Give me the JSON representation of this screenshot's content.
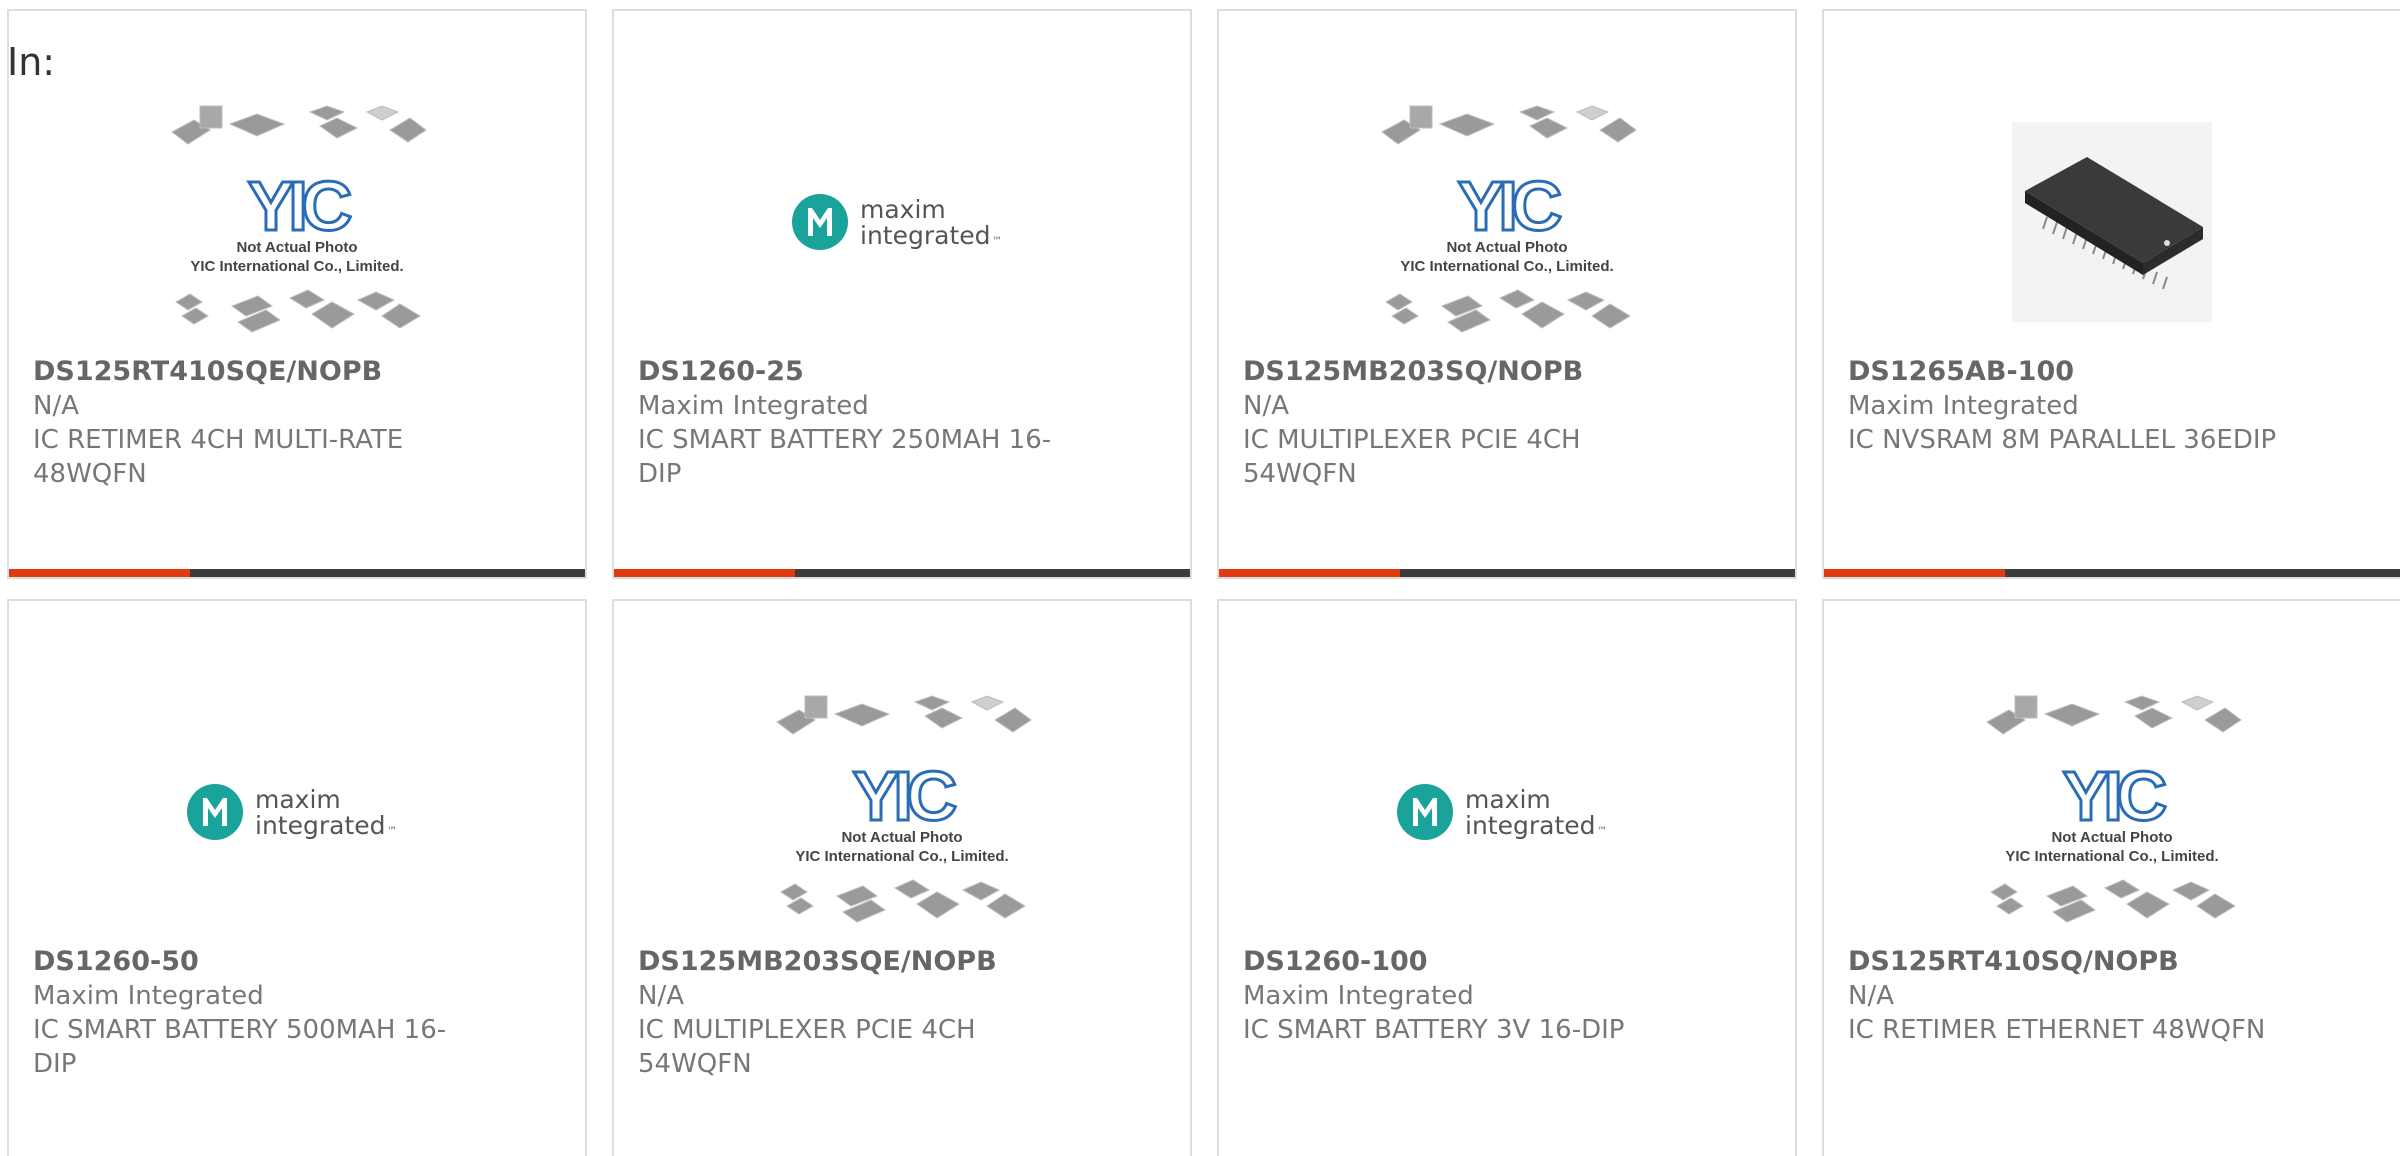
{
  "header": {
    "in_label": "In:"
  },
  "placeholder": {
    "line1": "Not Actual Photo",
    "line2": "YIC International Co., Limited.",
    "logo": "YIC"
  },
  "maxim_logo": {
    "line1": "maxim",
    "line2": "integrated",
    "tm": "™"
  },
  "colors": {
    "accent": "#e03a10",
    "bar": "#3c3c3c",
    "maxim_teal": "#1aa39a",
    "yic_blue": "#2a6db5"
  },
  "products": [
    {
      "part": "DS125RT410SQE/NOPB",
      "maker": "N/A",
      "desc": "IC RETIMER 4CH MULTI-RATE 48WQFN",
      "image": "yic-placeholder"
    },
    {
      "part": "DS1260-25",
      "maker": "Maxim Integrated",
      "desc": "IC SMART BATTERY 250MAH 16-DIP",
      "image": "maxim-logo"
    },
    {
      "part": "DS125MB203SQ/NOPB",
      "maker": "N/A",
      "desc": "IC MULTIPLEXER PCIE 4CH 54WQFN",
      "image": "yic-placeholder"
    },
    {
      "part": "DS1265AB-100",
      "maker": "Maxim Integrated",
      "desc": "IC NVSRAM 8M PARALLEL 36EDIP",
      "image": "chip-photo"
    },
    {
      "part": "DS1260-50",
      "maker": "Maxim Integrated",
      "desc": "IC SMART BATTERY 500MAH 16-DIP",
      "image": "maxim-logo"
    },
    {
      "part": "DS125MB203SQE/NOPB",
      "maker": "N/A",
      "desc": "IC MULTIPLEXER PCIE 4CH 54WQFN",
      "image": "yic-placeholder"
    },
    {
      "part": "DS1260-100",
      "maker": "Maxim Integrated",
      "desc": "IC SMART BATTERY 3V 16-DIP",
      "image": "maxim-logo"
    },
    {
      "part": "DS125RT410SQ/NOPB",
      "maker": "N/A",
      "desc": "IC RETIMER ETHERNET 48WQFN",
      "image": "yic-placeholder"
    }
  ]
}
